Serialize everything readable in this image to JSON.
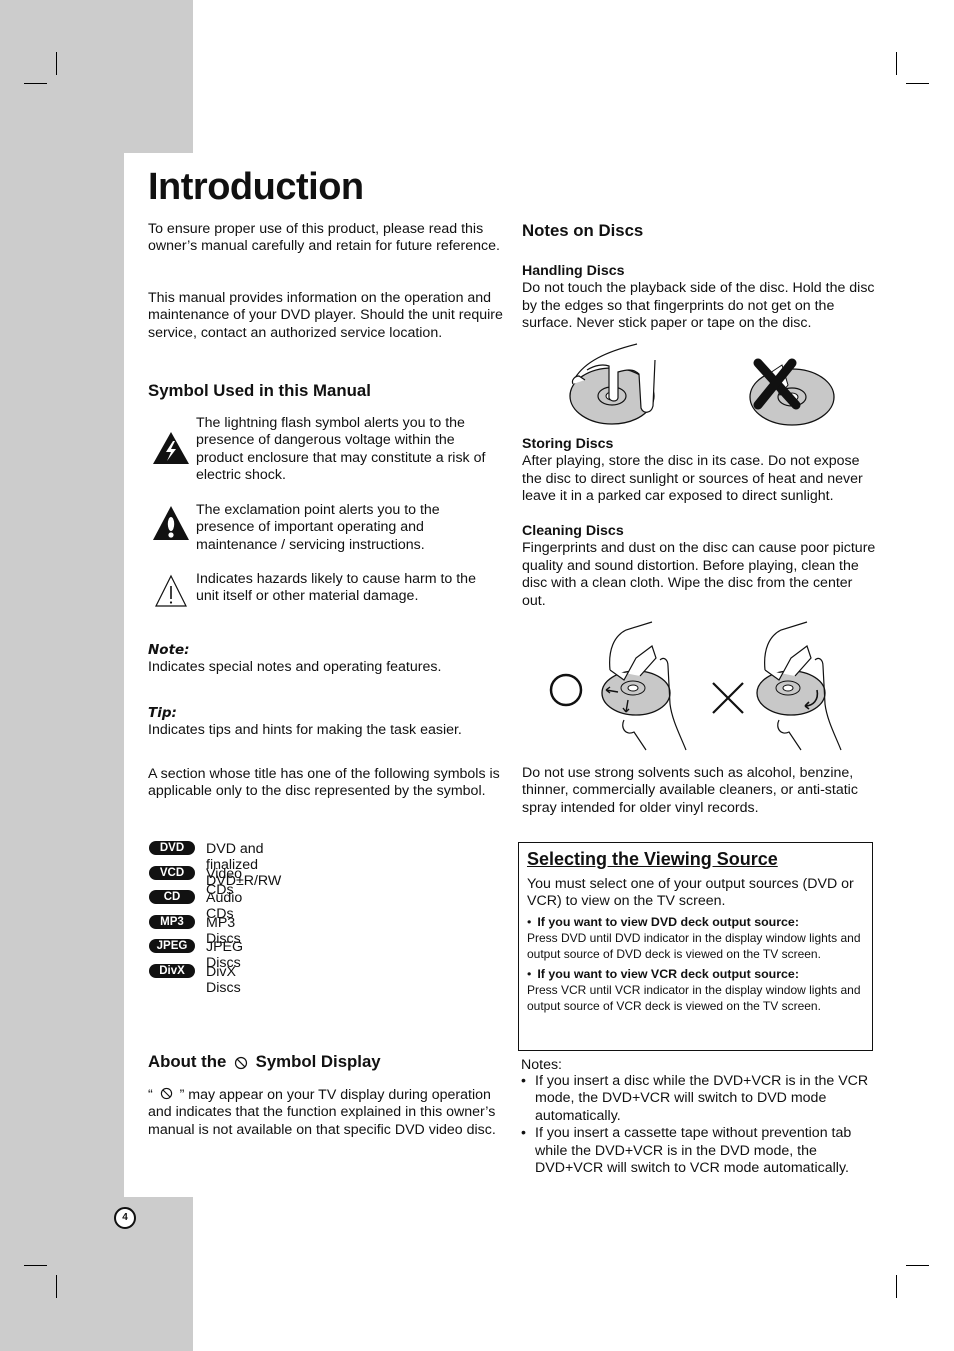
{
  "page": {
    "title": "Introduction",
    "page_number": "4",
    "colors": {
      "sidebar_gray": "#cccccc",
      "ink": "#111111"
    }
  },
  "intro": {
    "para1": "To ensure proper use of this product, please read this owner’s manual carefully and retain for future reference.",
    "para2": "This manual provides information on the operation and maintenance of your DVD player. Should the unit require service, contact an authorized service location."
  },
  "symbols": {
    "heading": "Symbol Used in this Manual",
    "items": [
      {
        "icon": "lightning-warning-icon",
        "text": "The lightning flash symbol alerts you to the presence of dangerous voltage within the product enclosure that may constitute a risk of electric shock."
      },
      {
        "icon": "exclamation-warning-icon",
        "text": "The exclamation point alerts you to the presence of important operating and maintenance / servicing instructions."
      },
      {
        "icon": "caution-outline-icon",
        "text": "Indicates hazards likely to cause harm to the unit itself or other material damage."
      }
    ],
    "note_label": "Note:",
    "note_text": "Indicates special notes and operating features.",
    "tip_label": "Tip:",
    "tip_text": "Indicates tips and hints for making the task easier.",
    "section_text": "A section whose title has one of the following symbols is applicable only to the disc represented by the symbol."
  },
  "discs": [
    {
      "badge": "DVD",
      "label": "DVD and finalized DVD±R/RW"
    },
    {
      "badge": "VCD",
      "label": "Video CDs"
    },
    {
      "badge": "CD",
      "label": "Audio CDs"
    },
    {
      "badge": "MP3",
      "label": "MP3 Discs"
    },
    {
      "badge": "JPEG",
      "label": "JPEG Discs"
    },
    {
      "badge": "DivX",
      "label": "DivX Discs"
    }
  ],
  "about_symbol": {
    "heading_pre": "About the",
    "heading_post": "Symbol Display",
    "quote_open": "“",
    "quote_close": "” may appear on your TV display during",
    "text_rest": "operation and indicates that the function explained in this owner’s manual is not available on that specific DVD video disc."
  },
  "notes_on_discs": {
    "heading": "Notes on Discs",
    "handling_heading": "Handling Discs",
    "handling_text": "Do not touch the playback side of the disc. Hold the disc by the edges so that fingerprints do not get on the surface. Never stick paper or tape on the disc.",
    "storing_heading": "Storing Discs",
    "storing_text": "After playing, store the disc in its case. Do not expose the disc to direct sunlight or sources of heat and never leave it in a parked car exposed to direct sunlight.",
    "cleaning_heading": "Cleaning Discs",
    "cleaning_text": "Fingerprints and dust on the disc can cause poor picture quality and sound distortion. Before playing, clean the disc with a clean cloth. Wipe the disc from the center out.",
    "solvents_text": "Do not use strong solvents such as alcohol, benzine, thinner, commercially available cleaners, or anti-static spray intended for older vinyl records."
  },
  "viewing_source": {
    "heading": "Selecting the Viewing Source",
    "intro": "You must select one of your output sources (DVD or VCR) to view on the TV screen.",
    "dvd_heading": "If you want to view DVD deck output source:",
    "dvd_text": "Press DVD until DVD indicator in the display window lights and output source of DVD deck is viewed on the TV screen.",
    "vcr_heading": "If you want to view VCR deck output source:",
    "vcr_text": "Press VCR until VCR indicator in the display window lights and output source of VCR deck is viewed on the TV screen.",
    "bullet": "•"
  },
  "notes": {
    "label": "Notes:",
    "items": [
      "If you insert a disc while the DVD+VCR is in the VCR mode, the DVD+VCR will switch to DVD mode automatically.",
      "If you insert a cassette tape without prevention tab while the DVD+VCR is in the DVD mode, the DVD+VCR will switch to VCR mode automatically."
    ]
  }
}
